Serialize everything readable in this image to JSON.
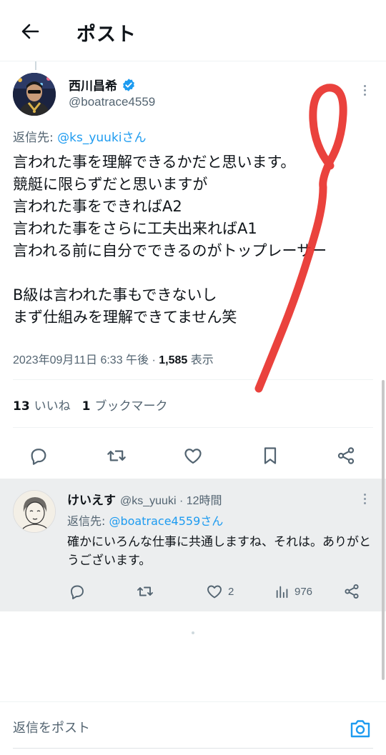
{
  "header": {
    "title": "ポスト"
  },
  "tweet": {
    "author_name": "西川昌希",
    "author_handle": "@boatrace4559",
    "reply_prefix": "返信先: ",
    "reply_to": "@ks_yuukiさん",
    "body": "言われた事を理解できるかだと思います。\n競艇に限らずだと思いますが\n言われた事をできればA2\n言われた事をさらに工夫出来ればA1\n言われる前に自分でできるのがトップレーサー\n\nB級は言われた事もできないし\nまず仕組みを理解できてません笑",
    "timestamp": "2023年09月11日 6:33 午後 · ",
    "views_count": "1,585",
    "views_label": " 表示",
    "likes_count": "13",
    "likes_label": "いいね",
    "bookmarks_count": "1",
    "bookmarks_label": "ブックマーク"
  },
  "reply": {
    "author_name": "けいえす",
    "author_handle": "@ks_yuuki · 12時間",
    "reply_prefix": "返信先: ",
    "reply_to": "@boatrace4559さん",
    "body": "確かにいろんな仕事に共通しますね、それは。ありがとうございます。",
    "like_count": "2",
    "view_count": "976"
  },
  "compose": {
    "placeholder": "返信をポスト"
  },
  "colors": {
    "link": "#1d9bf0",
    "verified": "#1d9bf0",
    "annotation": "#e8322c",
    "reply_bg": "#eceeef"
  },
  "icons": [
    "back-arrow-icon",
    "verified-badge-icon",
    "more-icon",
    "reply-icon",
    "repost-icon",
    "like-icon",
    "bookmark-icon",
    "share-icon",
    "views-icon",
    "camera-icon"
  ]
}
